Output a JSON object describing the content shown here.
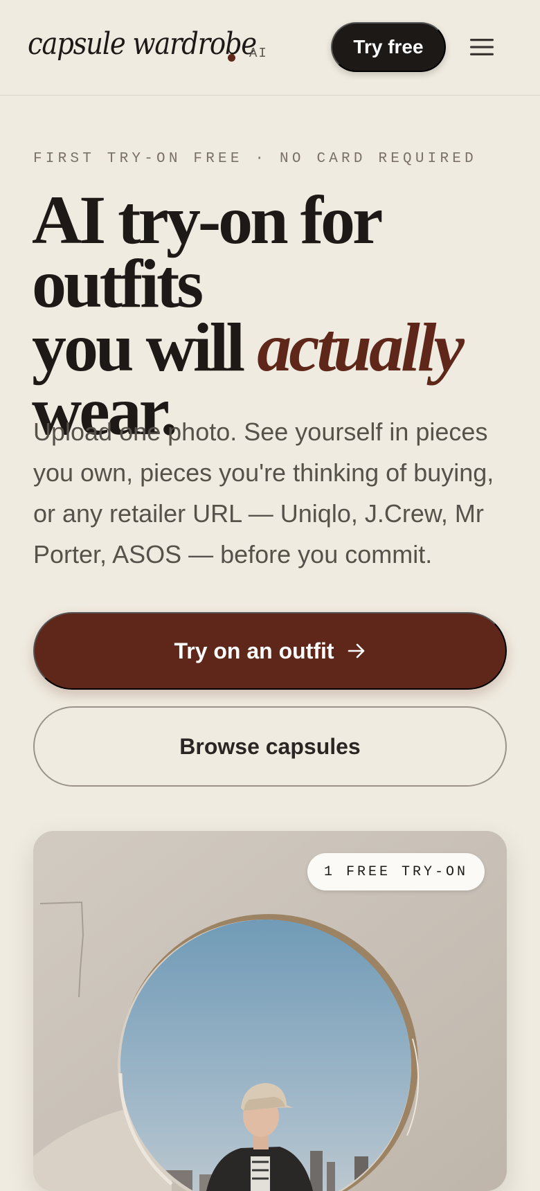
{
  "header": {
    "logo_text": "capsule wardrobe",
    "logo_badge": "AI",
    "try_free_label": "Try free",
    "menu_icon": "hamburger-icon"
  },
  "hero": {
    "eyebrow": "FIRST TRY-ON FREE · NO CARD REQUIRED",
    "headline_line1": "AI try-on for outfits",
    "headline_line2_start": "you will ",
    "headline_emphasis": "actually",
    "headline_line3": "wear.",
    "lede": "Upload one photo. See yourself in pieces you own, pieces you're thinking of buying, or any retailer URL — Uniqlo, J.Crew, Mr Porter, ASOS — before you commit."
  },
  "cta": {
    "primary_label": "Try on an outfit",
    "primary_icon": "arrow-right-icon",
    "secondary_label": "Browse capsules"
  },
  "showcase": {
    "badge": "1 FREE TRY-ON"
  },
  "colors": {
    "background": "#f0ebe0",
    "ink": "#1c1917",
    "accent": "#5e271a",
    "muted": "#57514b"
  }
}
